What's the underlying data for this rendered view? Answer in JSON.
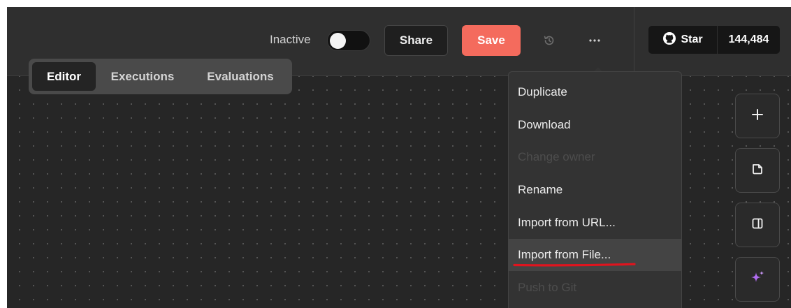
{
  "header": {
    "toggle_label": "Inactive",
    "toggle_on": false,
    "share_label": "Share",
    "save_label": "Save",
    "history_icon": "history-icon",
    "more_icon": "ellipsis-icon",
    "github": {
      "icon": "github-icon",
      "star_label": "Star",
      "count": "144,484"
    }
  },
  "tabs": [
    {
      "label": "Editor",
      "active": true
    },
    {
      "label": "Executions",
      "active": false
    },
    {
      "label": "Evaluations",
      "active": false
    }
  ],
  "menu": {
    "items": [
      {
        "label": "Duplicate",
        "disabled": false
      },
      {
        "label": "Download",
        "disabled": false
      },
      {
        "label": "Change owner",
        "disabled": true
      },
      {
        "label": "Rename",
        "disabled": false
      },
      {
        "label": "Import from URL...",
        "disabled": false
      },
      {
        "label": "Import from File...",
        "disabled": false,
        "highlighted": true,
        "annotated": true
      },
      {
        "label": "Push to Git",
        "disabled": true
      }
    ]
  },
  "side_buttons": [
    {
      "icon": "plus-icon"
    },
    {
      "icon": "sticky-note-icon"
    },
    {
      "icon": "panel-icon"
    },
    {
      "icon": "sparkle-ai-icon"
    }
  ],
  "colors": {
    "save": "#f46b5d",
    "canvas": "#262626",
    "header": "#2f2f2f",
    "annotation": "#e0141e",
    "ai_accent": "#b06cf0"
  }
}
